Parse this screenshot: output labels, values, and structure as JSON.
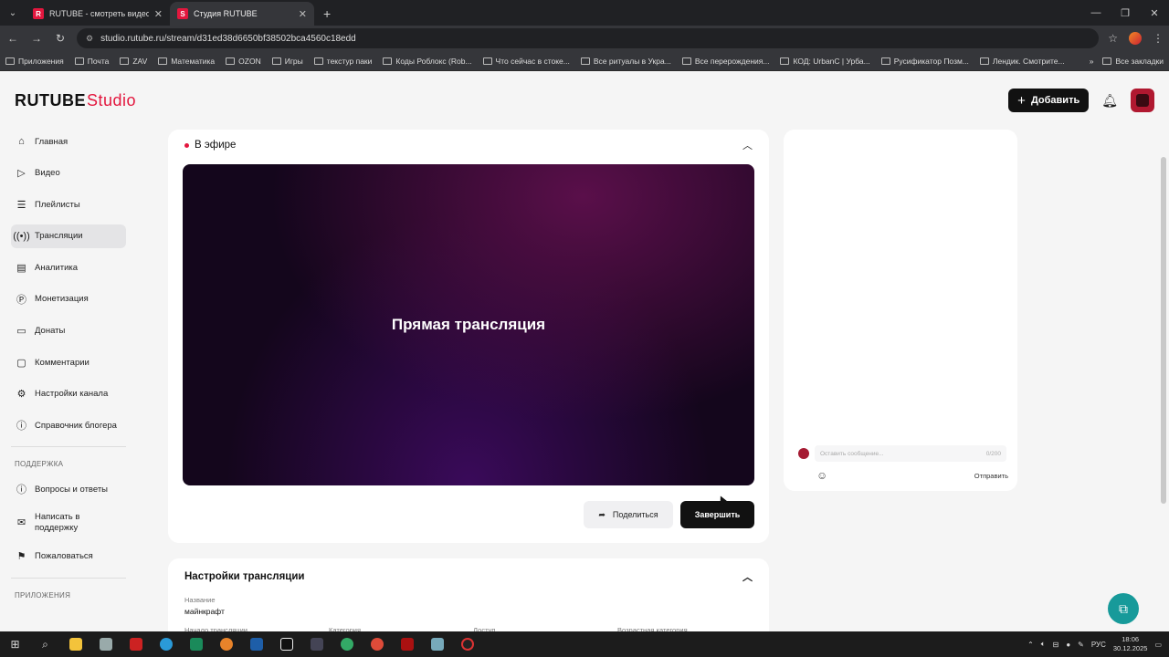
{
  "browser": {
    "tabs": [
      {
        "title": "RUTUBE - смотреть видео онлайн"
      },
      {
        "title": "Студия RUTUBE"
      }
    ],
    "url": "studio.rutube.ru/stream/d31ed38d6650bf38502bca4560c18edd",
    "bookmarks": [
      "Приложения",
      "Почта",
      "ZAV",
      "Математика",
      "OZON",
      "Игры",
      "текстур паки",
      "Коды Роблокс (Rob...",
      "Что сейчас в стоке...",
      "Все ритуалы в Укра...",
      "Все перерождения...",
      "КОД: UrbanC | Урба...",
      "Русификатор Позм...",
      "Лендик. Смотрите..."
    ],
    "bookmarks_right": "Все закладки"
  },
  "header": {
    "logo_main": "RUTUBE",
    "logo_studio": "Studio",
    "add_label": "Добавить"
  },
  "sidebar": {
    "items": [
      {
        "label": "Главная",
        "icon": "home-icon"
      },
      {
        "label": "Видео",
        "icon": "video-icon"
      },
      {
        "label": "Плейлисты",
        "icon": "playlist-icon"
      },
      {
        "label": "Трансляции",
        "icon": "broadcast-icon"
      },
      {
        "label": "Аналитика",
        "icon": "analytics-icon"
      },
      {
        "label": "Монетизация",
        "icon": "money-icon"
      },
      {
        "label": "Донаты",
        "icon": "donate-icon"
      },
      {
        "label": "Комментарии",
        "icon": "comment-icon"
      },
      {
        "label": "Настройки канала",
        "icon": "gear-icon"
      },
      {
        "label": "Справочник блогера",
        "icon": "info-icon"
      }
    ],
    "support_title": "ПОДДЕРЖКА",
    "support_items": [
      {
        "label": "Вопросы и ответы"
      },
      {
        "label": "Написать в поддержку"
      },
      {
        "label": "Пожаловаться"
      }
    ],
    "apps_title": "ПРИЛОЖЕНИЯ"
  },
  "live": {
    "status": "В эфире",
    "player_text": "Прямая трансляция",
    "share_label": "Поделиться",
    "finish_label": "Завершить"
  },
  "settings": {
    "title": "Настройки трансляции",
    "name_label": "Название",
    "name_value": "майнкрафт",
    "start_label": "Начало трансляции",
    "category_label": "Категория",
    "access_label": "Доступ",
    "age_label": "Возрастная категория"
  },
  "chat": {
    "placeholder": "Оставить сообщение...",
    "counter": "0/200",
    "send_label": "Отправить"
  },
  "taskbar": {
    "lang": "РУС",
    "time": "18:06",
    "date": "30.12.2025"
  },
  "colors": {
    "accent": "#e3173e",
    "dark": "#111111",
    "fab": "#179a9a"
  }
}
